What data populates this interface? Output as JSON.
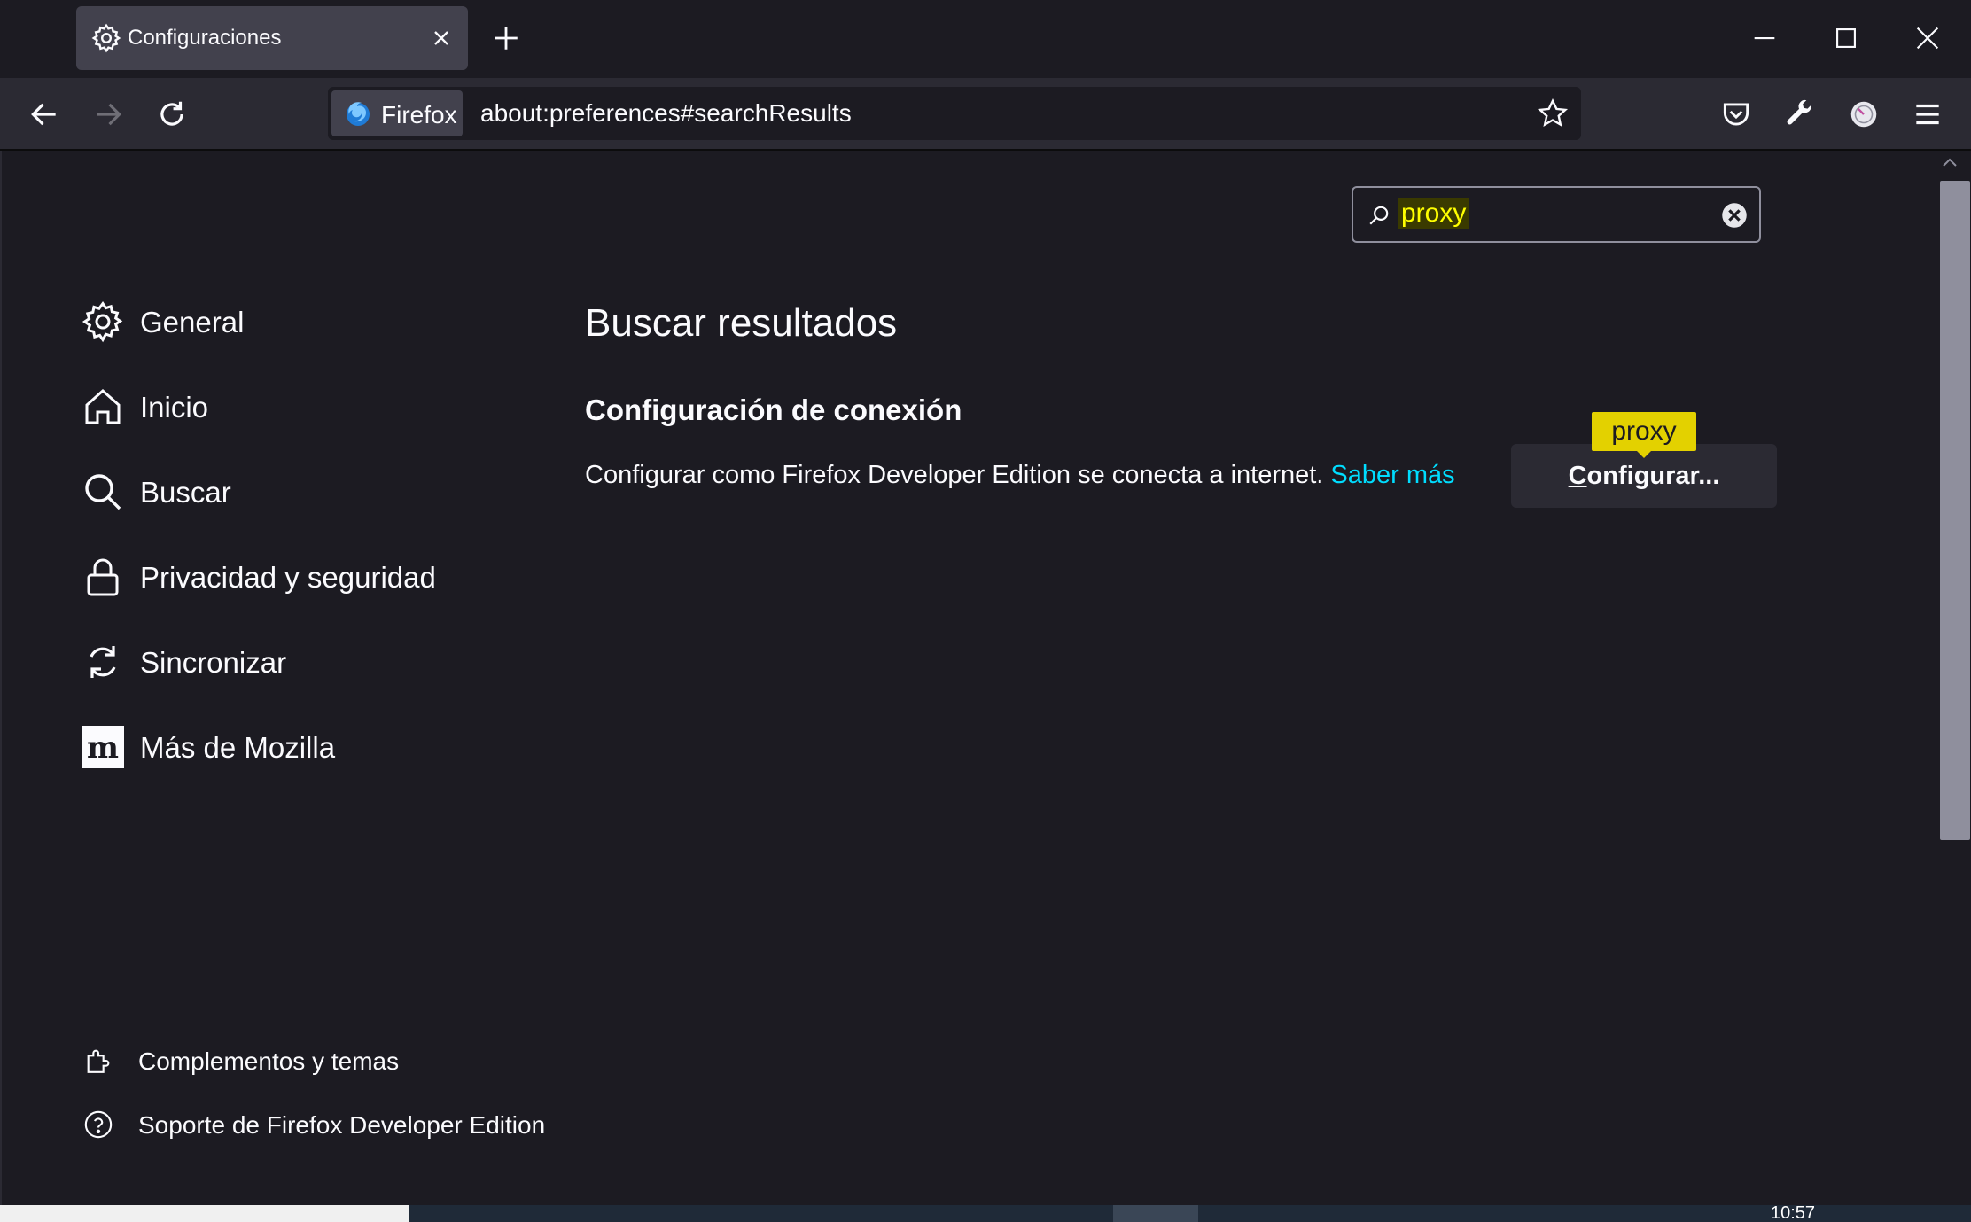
{
  "window": {
    "tab_title": "Configuraciones"
  },
  "navbar": {
    "identity_label": "Firefox",
    "url": "about:preferences#searchResults"
  },
  "search": {
    "value": "proxy"
  },
  "sidebar": {
    "categories": [
      {
        "label": "General",
        "icon": "gear-icon"
      },
      {
        "label": "Inicio",
        "icon": "home-icon"
      },
      {
        "label": "Buscar",
        "icon": "search-icon"
      },
      {
        "label": "Privacidad y seguridad",
        "icon": "lock-icon"
      },
      {
        "label": "Sincronizar",
        "icon": "sync-icon"
      },
      {
        "label": "Más de Mozilla",
        "icon": "mozilla-icon"
      }
    ],
    "footer": [
      {
        "label": "Complementos y temas",
        "icon": "puzzle-icon"
      },
      {
        "label": "Soporte de Firefox Developer Edition",
        "icon": "help-icon"
      }
    ]
  },
  "main": {
    "title": "Buscar resultados",
    "group_title": "Configuración de conexión",
    "description": "Configurar como Firefox Developer Edition se conecta a internet.",
    "learn_more": "Saber más",
    "configure_first": "C",
    "configure_rest": "onfigurar...",
    "tooltip": "proxy"
  },
  "taskbar": {
    "clock": "10:57"
  },
  "colors": {
    "background": "#1c1b22",
    "toolbar": "#2b2a33",
    "link": "#00ddff",
    "highlight": "#e3d100"
  }
}
